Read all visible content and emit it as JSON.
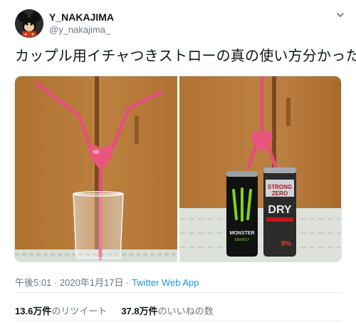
{
  "user": {
    "display_name": "Y_NAKAJIMA",
    "handle": "@y_nakajima_"
  },
  "tweet": {
    "text": "カップル用イチャつきストローの真の使い方分かった",
    "time": "午後5:01",
    "date": "2020年1月17日",
    "separator": " · ",
    "app": "Twitter Web App"
  },
  "stats": {
    "retweets_count": "13.6万件",
    "retweets_label": "のリツイート",
    "likes_count": "37.8万件",
    "likes_label": "のいいねの数"
  },
  "cans": {
    "monster_brand": "MONSTER",
    "monster_sub": "ENERGY",
    "strong_zero_top": "STRONG",
    "strong_zero_mid": "ZERO",
    "strong_zero_bottom": "DRY",
    "strong_zero_abv": "9%"
  },
  "icons": {
    "avatar": "mickey-avatar-icon",
    "caret": "chevron-down-icon"
  }
}
